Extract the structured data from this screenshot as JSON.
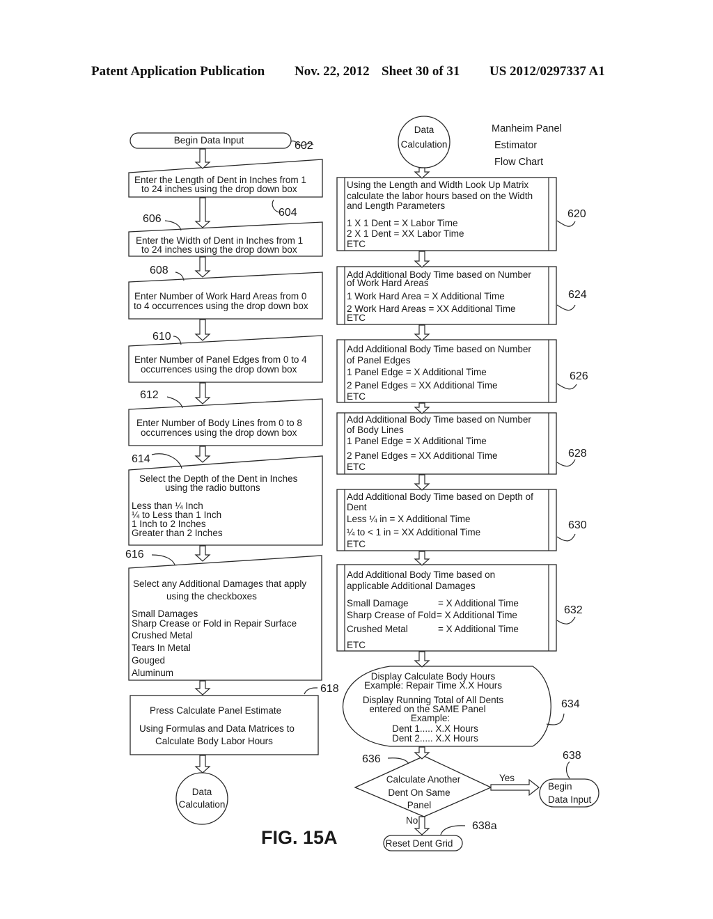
{
  "header": {
    "left": "Patent Application Publication",
    "date": "Nov. 22, 2012",
    "sheet": "Sheet 30 of 31",
    "number": "US 2012/0297337 A1"
  },
  "figure_label": "FIG. 15A",
  "chart_title": [
    "Manheim Panel",
    "Estimator",
    "Flow Chart"
  ],
  "left_column": {
    "begin": {
      "ref": "602",
      "label": "Begin Data Input"
    },
    "length": {
      "ref": "604",
      "lines": [
        "Enter the Length of Dent in Inches from 1",
        "to 24 inches using the drop down box"
      ]
    },
    "width": {
      "ref": "606",
      "lines": [
        "Enter the Width of Dent in Inches from 1",
        "to 24 inches using the drop down box"
      ]
    },
    "work_hard": {
      "ref": "608",
      "lines": [
        "Enter Number of Work Hard Areas from 0",
        "to 4 occurrences using the drop down box"
      ]
    },
    "panel_edges": {
      "ref": "610",
      "lines": [
        "Enter Number of Panel Edges from 0 to 4",
        "occurrences using the drop down box"
      ]
    },
    "body_lines": {
      "ref": "612",
      "lines": [
        "Enter Number of Body Lines from 0 to 8",
        "occurrences using the drop down box"
      ]
    },
    "depth": {
      "ref": "614",
      "lines": [
        "Select the Depth of the Dent in Inches",
        "using the radio buttons"
      ],
      "options": [
        "Less than ¼ Inch",
        "¼ to Less than 1 Inch",
        "1 Inch to 2 Inches",
        "Greater than 2 Inches"
      ]
    },
    "damages": {
      "ref": "616",
      "lines": [
        "Select any Additional Damages that apply",
        "using the checkboxes"
      ],
      "options": [
        "Small Damages",
        "Sharp Crease or Fold in Repair Surface",
        "Crushed Metal",
        "Tears In Metal",
        "Gouged",
        "Aluminum"
      ]
    },
    "calculate": {
      "ref": "618",
      "lines": [
        "Press Calculate Panel Estimate",
        "Using Formulas and Data Matrices to",
        "Calculate Body Labor Hours"
      ]
    },
    "connector": [
      "Data",
      "Calculation"
    ]
  },
  "right_column": {
    "connector": [
      "Data",
      "Calculation"
    ],
    "matrix": {
      "ref": "620",
      "lines": [
        "Using the Length and Width Look Up Matrix",
        "calculate the labor hours based on the Width",
        "and Length Parameters",
        "1 X 1 Dent = X Labor Time",
        "2 X 1 Dent = XX Labor Time",
        "ETC"
      ]
    },
    "work_hard": {
      "ref": "624",
      "lines": [
        "Add Additional Body Time based on Number",
        "of Work Hard Areas",
        "1 Work Hard Area   = X Additional Time",
        "2 Work Hard Areas = XX Additional Time",
        "ETC"
      ]
    },
    "panel_edges": {
      "ref": "626",
      "lines": [
        "Add Additional Body Time based on Number",
        "of Panel Edges",
        "1 Panel Edge   = X Additional Time",
        "2 Panel Edges = XX Additional Time",
        "ETC"
      ]
    },
    "body_lines": {
      "ref": "628",
      "lines": [
        "Add Additional Body Time based on Number",
        "of Body Lines",
        "1 Panel Edge   = X Additional Time",
        "2 Panel Edges = XX Additional Time",
        "ETC"
      ]
    },
    "depth": {
      "ref": "630",
      "lines": [
        "Add Additional Body Time based on Depth of",
        "Dent",
        "Less ¼ in   = X Additional Time",
        "¼ to < 1 in  = XX Additional Time",
        "ETC"
      ]
    },
    "damages": {
      "ref": "632",
      "lines": [
        "Add Additional Body Time based on",
        "applicable Additional Damages"
      ],
      "rows": [
        {
          "name": "Small Damage",
          "value": "= X Additional Time"
        },
        {
          "name": "Sharp Crease of Fold",
          "value": "= X Additional Time"
        },
        {
          "name": "Crushed Metal",
          "value": "= X Additional Time"
        }
      ],
      "etc": "ETC"
    },
    "display": {
      "ref": "634",
      "lines": [
        "Display Calculate Body Hours",
        "Example: Repair Time X.X Hours",
        "Display Running Total of All Dents",
        "entered on the SAME Panel",
        "Example:",
        "Dent 1..... X.X Hours",
        "Dent 2..... X.X Hours"
      ]
    },
    "decision": {
      "ref": "636",
      "lines": [
        "Calculate Another",
        "Dent On Same",
        "Panel"
      ],
      "yes": "Yes",
      "no": "No"
    },
    "begin_again": {
      "ref": "638",
      "lines": [
        "Begin",
        "Data Input"
      ]
    },
    "reset": {
      "ref": "638a",
      "label": "Reset Dent Grid"
    }
  }
}
